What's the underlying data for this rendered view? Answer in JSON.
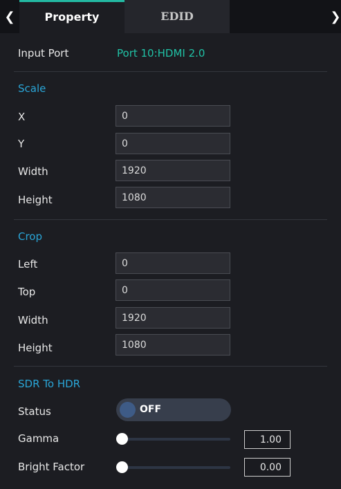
{
  "tabs": {
    "property": "Property",
    "edid": "EDID"
  },
  "input_port": {
    "label": "Input Port",
    "value": "Port 10:HDMI 2.0"
  },
  "scale": {
    "title": "Scale",
    "x_label": "X",
    "x_value": "0",
    "y_label": "Y",
    "y_value": "0",
    "width_label": "Width",
    "width_value": "1920",
    "height_label": "Height",
    "height_value": "1080"
  },
  "crop": {
    "title": "Crop",
    "left_label": "Left",
    "left_value": "0",
    "top_label": "Top",
    "top_value": "0",
    "width_label": "Width",
    "width_value": "1920",
    "height_label": "Height",
    "height_value": "1080"
  },
  "sdr_to_hdr": {
    "title": "SDR To HDR",
    "status_label": "Status",
    "status_value": "OFF",
    "gamma_label": "Gamma",
    "gamma_value": "1.00",
    "gamma_level": 0,
    "bright_label": "Bright Factor",
    "bright_value": "0.00",
    "bright_level": 0
  },
  "colors": {
    "accent_teal": "#23b9a2",
    "section_blue": "#2aa6d8",
    "background": "#1c1d22"
  },
  "icons": {
    "back": "chevron-left-icon",
    "next": "chevron-right-icon"
  }
}
